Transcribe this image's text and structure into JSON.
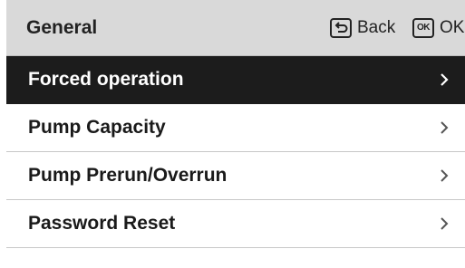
{
  "header": {
    "title": "General",
    "back_label": "Back",
    "ok_label": "OK",
    "ok_key_text": "OK",
    "back_icon": "back-return-icon",
    "ok_icon": "ok-key-icon"
  },
  "menu": {
    "items": [
      {
        "label": "Forced operation",
        "selected": true,
        "icon": "chevron-right-icon"
      },
      {
        "label": "Pump Capacity",
        "selected": false,
        "icon": "chevron-right-icon"
      },
      {
        "label": "Pump Prerun/Overrun",
        "selected": false,
        "icon": "chevron-right-icon"
      },
      {
        "label": "Password Reset",
        "selected": false,
        "icon": "chevron-right-icon"
      }
    ]
  },
  "colors": {
    "header_bg": "#d9d9d9",
    "selected_bg": "#1c1c1c",
    "text": "#1a1a1a",
    "selected_text": "#ffffff"
  }
}
